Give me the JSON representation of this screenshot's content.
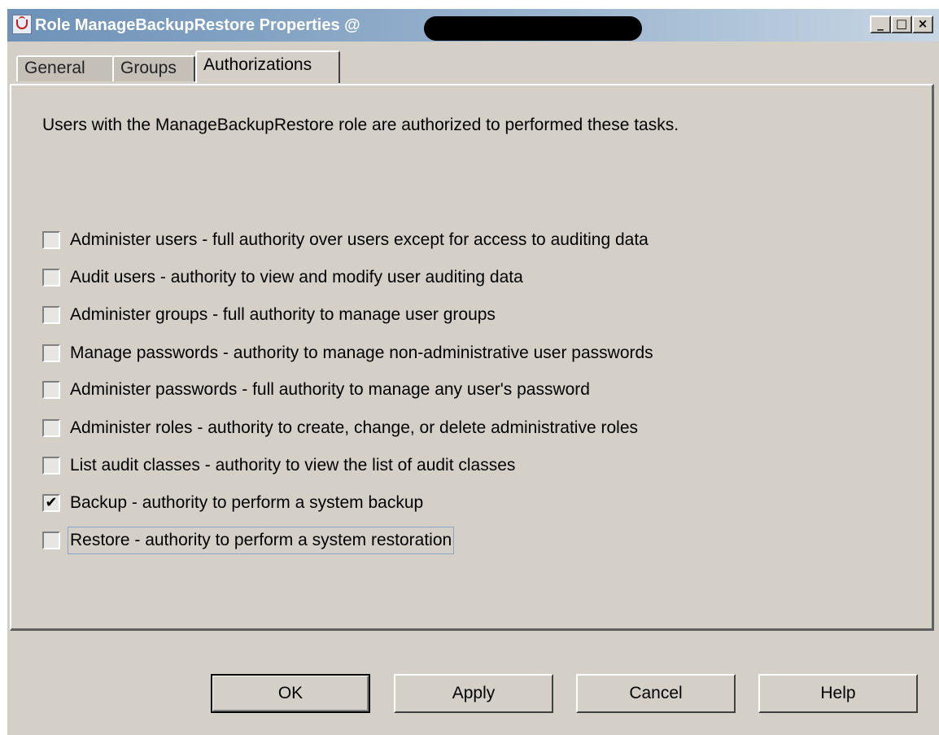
{
  "window": {
    "title": "Role ManageBackupRestore Properties @",
    "controls": {
      "minimize": "_",
      "maximize": "□",
      "close": "×"
    }
  },
  "tabs": [
    {
      "label": "General",
      "active": false
    },
    {
      "label": "Groups",
      "active": false
    },
    {
      "label": "Authorizations",
      "active": true
    }
  ],
  "panel": {
    "intro": "Users with the ManageBackupRestore role are authorized to performed these tasks.",
    "authorizations": [
      {
        "label": "Administer users - full authority over users except for access to auditing data",
        "checked": false
      },
      {
        "label": "Audit users - authority to view and modify user auditing data",
        "checked": false
      },
      {
        "label": "Administer groups - full authority to manage user groups",
        "checked": false
      },
      {
        "label": "Manage passwords - authority to manage non-administrative user passwords",
        "checked": false
      },
      {
        "label": "Administer passwords - full authority to manage any user's password",
        "checked": false
      },
      {
        "label": "Administer roles - authority to create, change, or delete administrative roles",
        "checked": false
      },
      {
        "label": "List audit classes - authority to view the list of audit classes",
        "checked": false
      },
      {
        "label": "Backup - authority to perform a system backup",
        "checked": true
      },
      {
        "label": "Restore - authority to perform a system restoration",
        "checked": false
      }
    ]
  },
  "buttons": {
    "ok": "OK",
    "apply": "Apply",
    "cancel": "Cancel",
    "help": "Help"
  }
}
